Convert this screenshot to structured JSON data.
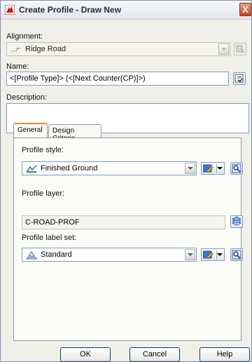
{
  "window": {
    "title": "Create Profile - Draw New",
    "close_label": "X"
  },
  "alignment": {
    "label": "Alignment:",
    "value": "Ridge Road"
  },
  "name": {
    "label": "Name:",
    "value": "<[Profile Type]> (<[Next Counter(CP)]>)"
  },
  "description": {
    "label": "Description:",
    "value": ""
  },
  "tabs": [
    {
      "label": "General"
    },
    {
      "label": "Design Criteria"
    }
  ],
  "general": {
    "profile_style": {
      "label": "Profile style:",
      "value": "Finished Ground"
    },
    "profile_layer": {
      "label": "Profile layer:",
      "value": "C-ROAD-PROF"
    },
    "profile_label_set": {
      "label": "Profile label set:",
      "value": "Standard"
    }
  },
  "buttons": {
    "ok": "OK",
    "cancel": "Cancel",
    "help": "Help"
  }
}
